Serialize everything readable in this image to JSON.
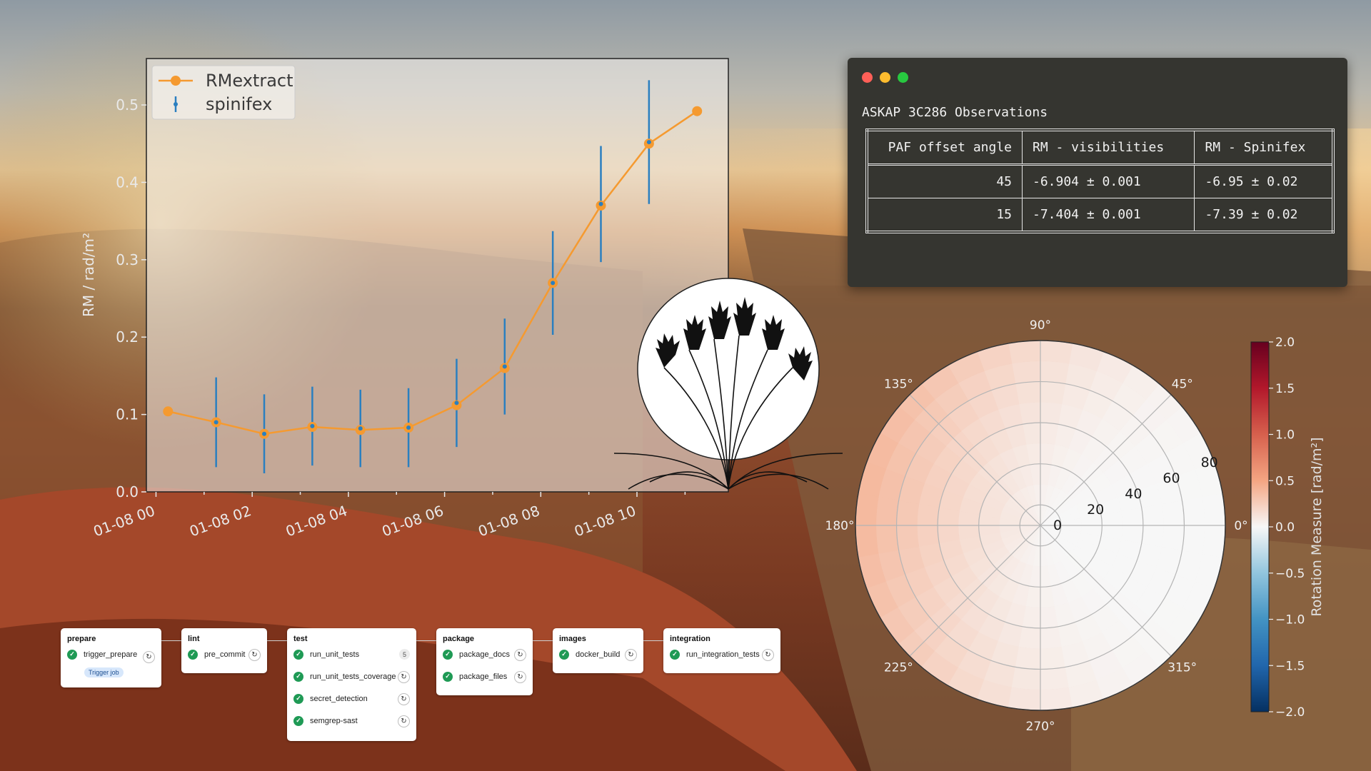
{
  "chart_data": [
    {
      "type": "line",
      "x": [
        "2024-01-08T00:15",
        "2024-01-08T01:15",
        "2024-01-08T02:15",
        "2024-01-08T03:15",
        "2024-01-08T04:15",
        "2024-01-08T05:15",
        "2024-01-08T06:15",
        "2024-01-08T07:15",
        "2024-01-08T08:15",
        "2024-01-08T09:15",
        "2024-01-08T10:15",
        "2024-01-08T11:15"
      ],
      "series": [
        {
          "name": "RMextract",
          "color": "#f59a30",
          "marker": "circle",
          "values": [
            0.104,
            0.09,
            0.075,
            0.084,
            0.08,
            0.083,
            0.112,
            0.16,
            0.27,
            0.37,
            0.45,
            0.492
          ]
        },
        {
          "name": "spinifex",
          "color": "#2a7fc0",
          "style": "errorbar",
          "values": [
            null,
            0.09,
            0.075,
            0.085,
            0.082,
            0.083,
            0.115,
            0.162,
            0.27,
            0.372,
            0.452,
            null
          ],
          "errors": [
            null,
            0.058,
            0.051,
            0.051,
            0.05,
            0.051,
            0.057,
            0.062,
            0.067,
            0.075,
            0.08,
            null
          ]
        }
      ],
      "xticks": [
        "01-08 00",
        "01-08 02",
        "01-08 04",
        "01-08 06",
        "01-08 08",
        "01-08 10"
      ],
      "yticks": [
        "0.0",
        "0.1",
        "0.2",
        "0.3",
        "0.4",
        "0.5"
      ],
      "ylabel": "RM / rad/m²",
      "ylim": [
        0.0,
        0.56
      ],
      "grid": false,
      "legend": "top-left"
    },
    {
      "type": "heatmap",
      "projection": "polar",
      "angle_ticks": [
        "0°",
        "45°",
        "90°",
        "135°",
        "180°",
        "225°",
        "270°",
        "315°"
      ],
      "radial_ticks": [
        "0",
        "20",
        "40",
        "60",
        "80"
      ],
      "rlim": [
        0,
        90
      ],
      "colorbar": {
        "label": "Rotation Measure [rad/m²]",
        "ticks": [
          "2.0",
          "1.5",
          "1.0",
          "0.5",
          "0.0",
          "−0.5",
          "−1.0",
          "−1.5",
          "−2.0"
        ],
        "range": [
          -2.0,
          2.0
        ],
        "colormap": "RdBu_r"
      },
      "description_values": {
        "max_rm": 0.8,
        "max_angle_deg": 170,
        "min_rm": 0.0
      }
    }
  ],
  "terminal": {
    "title": "ASKAP 3C286 Observations",
    "columns": [
      "PAF offset angle",
      "RM - visibilities",
      "RM - Spinifex"
    ],
    "rows": [
      [
        "45",
        "-6.904 ± 0.001",
        "-6.95 ± 0.02"
      ],
      [
        "15",
        "-7.404 ± 0.001",
        "-7.39 ± 0.02"
      ]
    ]
  },
  "pipeline": {
    "stages": [
      {
        "name": "prepare",
        "jobs": [
          {
            "name": "trigger_prepare",
            "badge": "Trigger job"
          }
        ]
      },
      {
        "name": "lint",
        "jobs": [
          {
            "name": "pre_commit"
          }
        ]
      },
      {
        "name": "test",
        "jobs": [
          {
            "name": "run_unit_tests",
            "count": "5"
          },
          {
            "name": "run_unit_tests_coverage"
          },
          {
            "name": "secret_detection"
          },
          {
            "name": "semgrep-sast"
          }
        ]
      },
      {
        "name": "package",
        "jobs": [
          {
            "name": "package_docs"
          },
          {
            "name": "package_files"
          }
        ]
      },
      {
        "name": "images",
        "jobs": [
          {
            "name": "docker_build"
          }
        ]
      },
      {
        "name": "integration",
        "jobs": [
          {
            "name": "run_integration_tests"
          }
        ]
      }
    ]
  }
}
